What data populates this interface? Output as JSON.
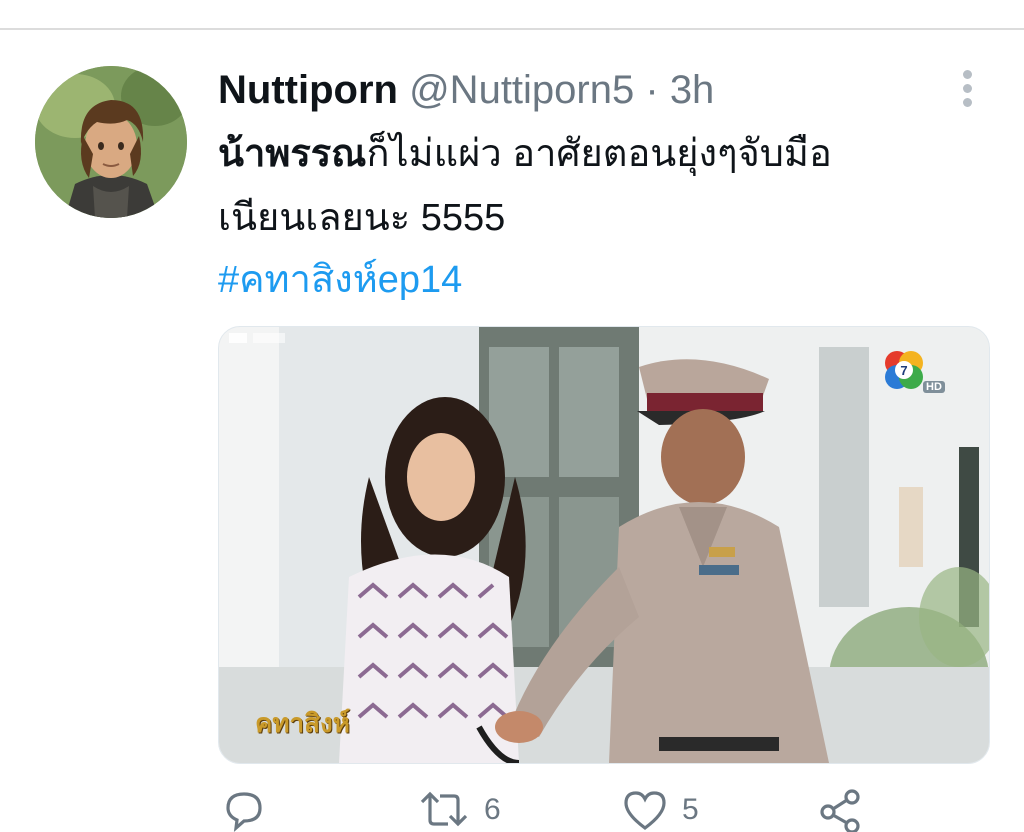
{
  "tweet": {
    "display_name": "Nuttiporn",
    "handle": "@Nuttiporn5",
    "separator": "·",
    "time": "3h",
    "text_bold": "น้าพรรณ",
    "text_line1_rest": "ก็ไม่แผ่ว อาศัยตอนยุ่งๆจับมือ",
    "text_line2": "เนียนเลยนะ 5555",
    "hashtag": "#คทาสิงห์ep14",
    "media": {
      "logo_text": "คทาสิงห์",
      "hd_label": "HD"
    },
    "actions": {
      "reply_count": "",
      "retweet_count": "6",
      "like_count": "5"
    },
    "icons": [
      "more-vertical-icon",
      "reply-icon",
      "retweet-icon",
      "like-icon",
      "share-icon"
    ],
    "colors": {
      "link": "#1d9bf0",
      "secondary_text": "#6b7782",
      "primary_text": "#0f1419"
    }
  }
}
